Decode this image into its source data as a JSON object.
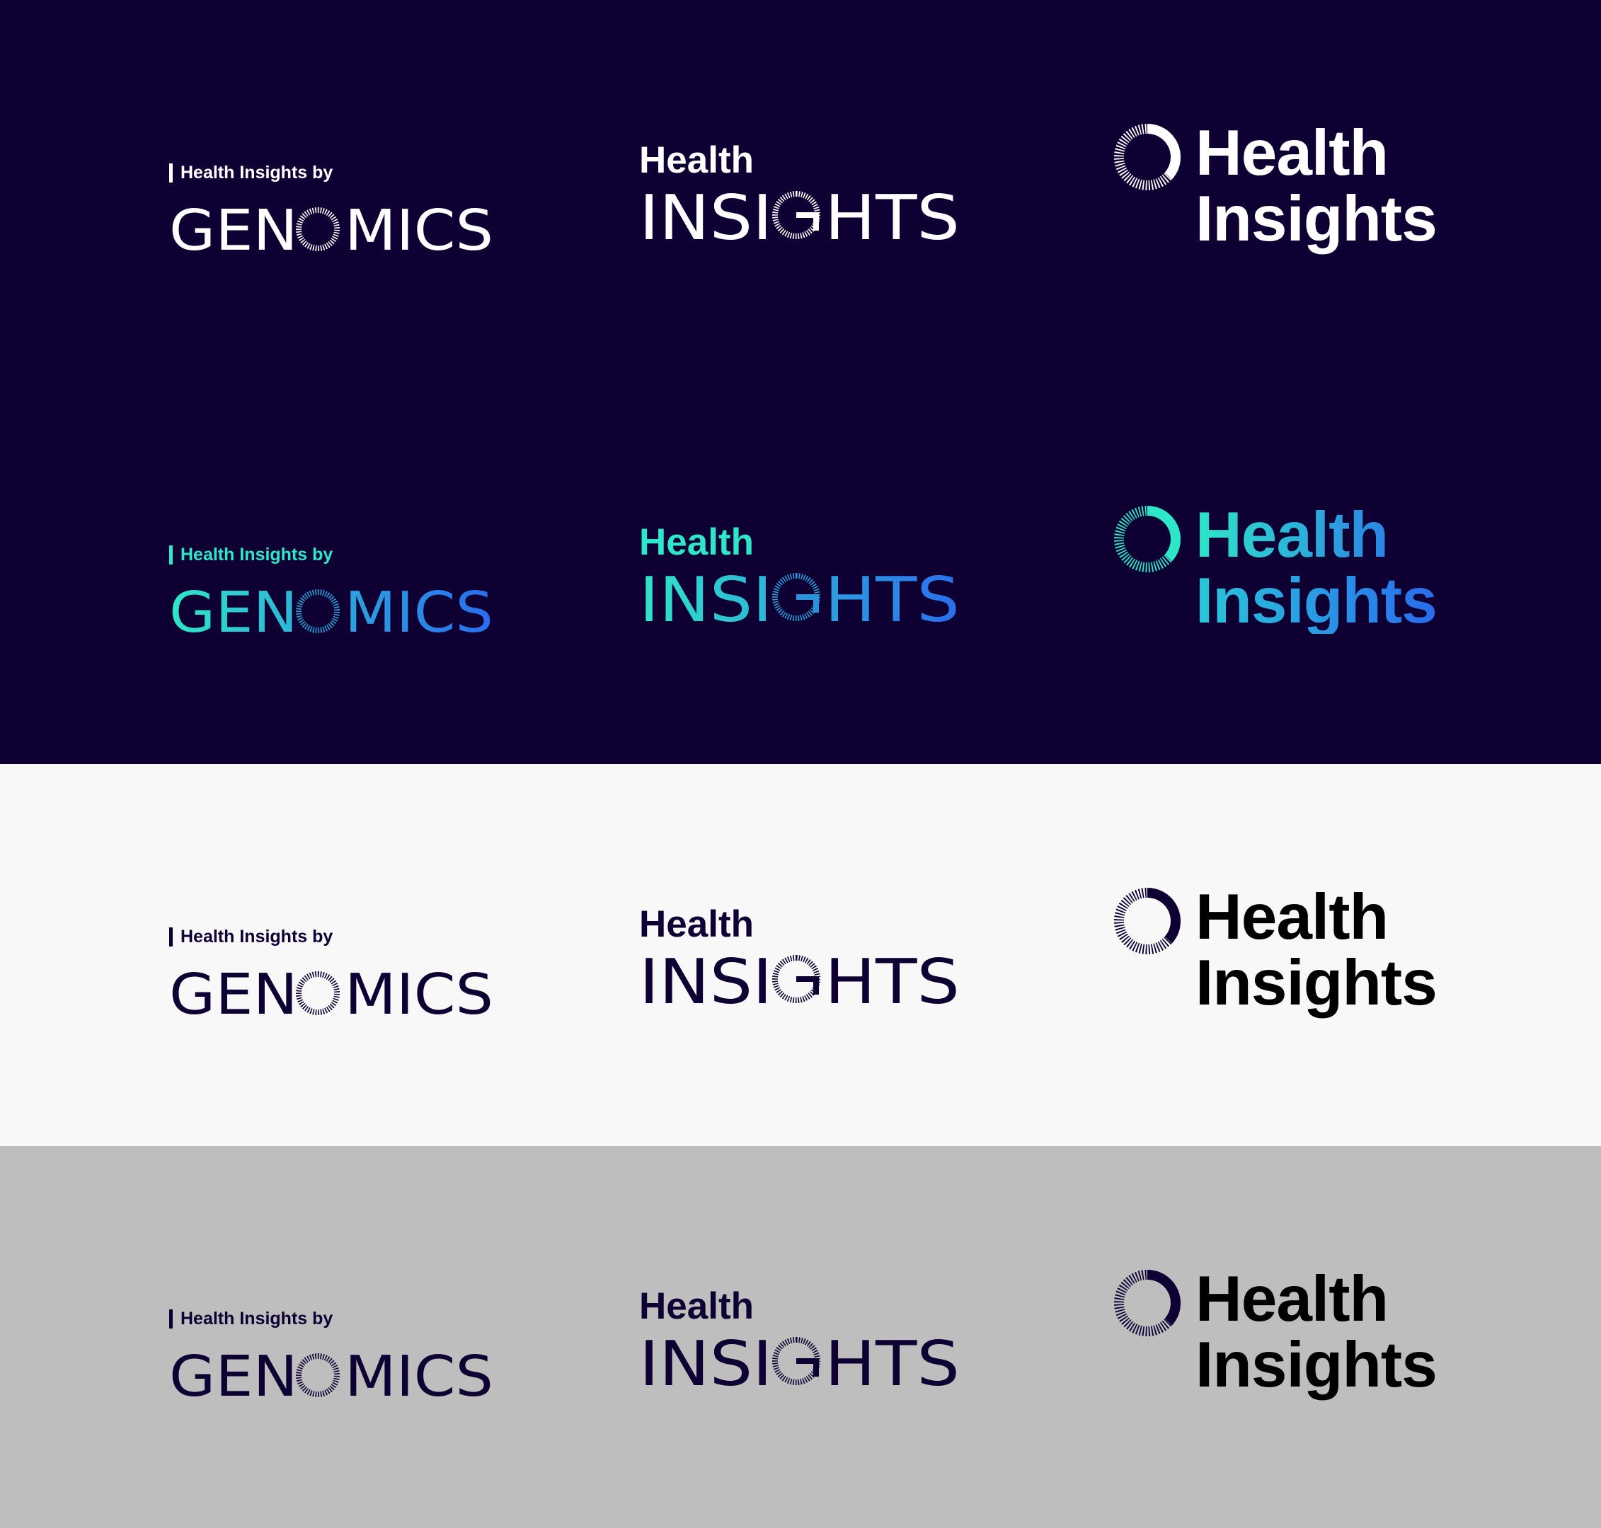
{
  "palette": {
    "navy": "#0f0033",
    "white": "#ffffff",
    "light_gray": "#f8f8f8",
    "mid_gray": "#bebebe",
    "black": "#000000",
    "teal": "#2ee6c8",
    "blue": "#2a6bee"
  },
  "logo_text": {
    "byline": "Health Insights by",
    "genomics": "GENOMICS",
    "health": "Health",
    "insights_caps": "INSIGHTS",
    "insights": "Insights"
  },
  "rows": [
    {
      "name": "white-on-navy",
      "background": "#0f0033",
      "colorway": "white"
    },
    {
      "name": "gradient-on-navy",
      "background": "#0f0033",
      "colorway": "gradient"
    },
    {
      "name": "navy-on-light",
      "background": "#f8f8f8",
      "colorway": "navy"
    },
    {
      "name": "navy-on-gray",
      "background": "#bebebe",
      "colorway": "navy"
    }
  ]
}
